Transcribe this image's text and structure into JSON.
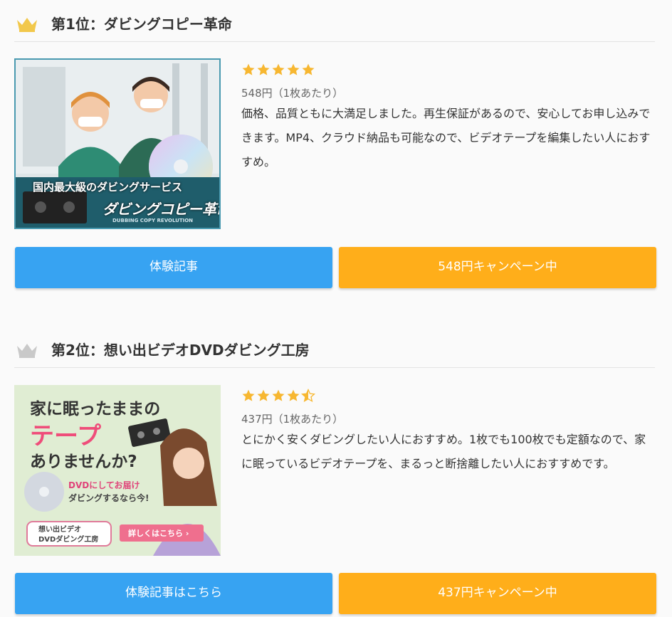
{
  "ranks": [
    {
      "title": "第1位：ダビングコピー革命",
      "rating": 5,
      "price": "548円（1枚あたり）",
      "description": "価格、品質ともに大満足しました。再生保証があるので、安心してお申し込みできます。MP4、クラウド納品も可能なので、ビデオテープを編集したい人におすすめ。",
      "button_left": "体験記事",
      "button_right": "548円キャンペーン中",
      "image_text": {
        "line1": "国内最大級のダビングサービス",
        "line2": "ダビングコピー革命",
        "line3": "DUBBING COPY REVOLUTION"
      },
      "crown_color": "#f2c84b"
    },
    {
      "title": "第2位：想い出ビデオDVDダビング工房",
      "rating": 4.5,
      "price": "437円（1枚あたり）",
      "description": "とにかく安くダビングしたい人におすすめ。1枚でも100枚でも定額なので、家に眠っているビデオテープを、まるっと断捨離したい人におすすめです。",
      "button_left": "体験記事はこちら",
      "button_right": "437円キャンペーン中",
      "image_text": {
        "line1": "家に眠ったままの",
        "line2": "テープ",
        "line3": "ありませんか?",
        "line4": "DVDにしてお届け",
        "line5": "ダビングするなら今!",
        "line6": "想い出ビデオ",
        "line7": "DVDダビング工房",
        "line8": "詳しくはこちら ›"
      },
      "crown_color": "#c9c9c9"
    }
  ],
  "colors": {
    "star": "#f7b731",
    "blue_button": "#37a3f2",
    "orange_button": "#ffae1a"
  }
}
